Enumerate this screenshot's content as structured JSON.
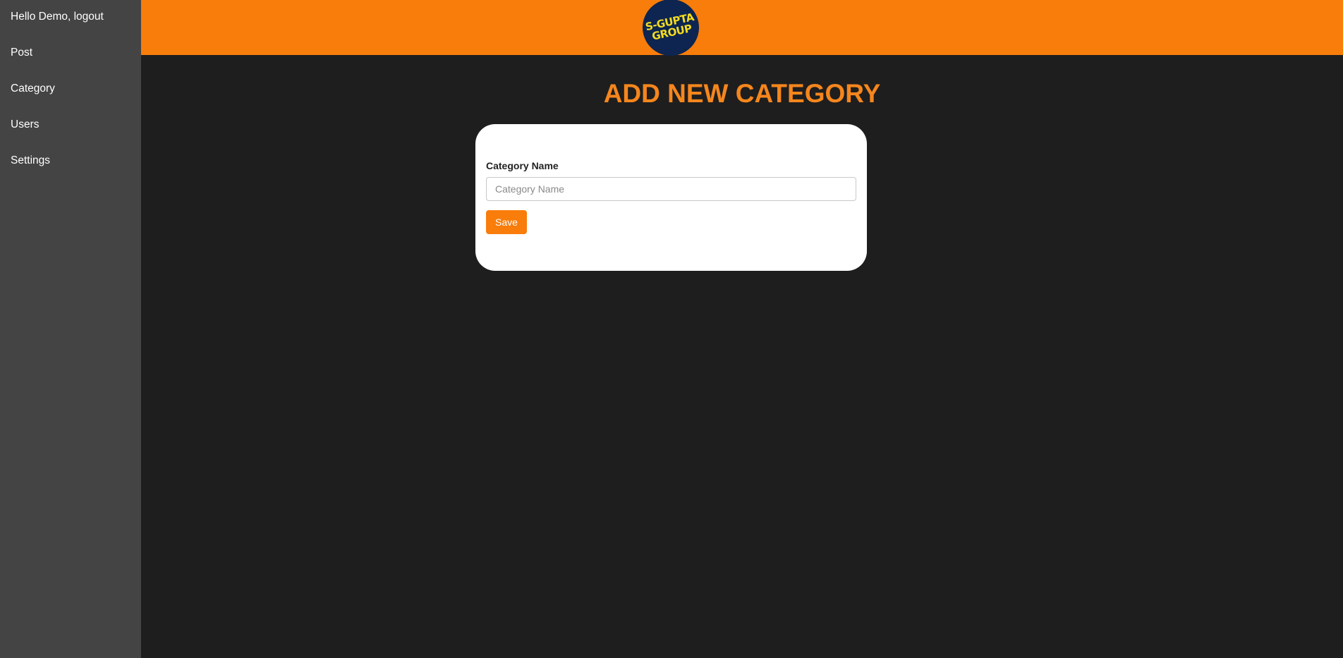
{
  "sidebar": {
    "items": [
      {
        "label": "Hello Demo, logout"
      },
      {
        "label": "Post"
      },
      {
        "label": "Category"
      },
      {
        "label": "Users"
      },
      {
        "label": "Settings"
      }
    ]
  },
  "header": {
    "logo": {
      "line1": "S-GUPTA",
      "line2": "GROUP",
      "background": "#0d2550",
      "text_color": "#f5dc1e"
    },
    "background": "#f97d0b"
  },
  "main": {
    "title": "ADD NEW CATEGORY",
    "form": {
      "field_label": "Category Name",
      "field_value": "",
      "field_placeholder": "Category Name",
      "save_label": "Save"
    }
  },
  "colors": {
    "accent": "#f97d0b",
    "title": "#f5861d",
    "sidebar_bg": "#444444",
    "page_bg": "#1e1e1e"
  }
}
